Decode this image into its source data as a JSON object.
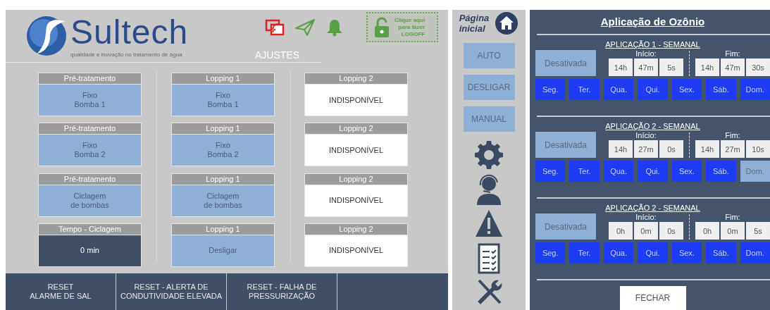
{
  "header": {
    "brand": "Sultech",
    "tagline": "qualidade e inovação no tratamento de água",
    "logoff": "Clique aqui\npara fazer\nLOGOFF",
    "section_title": "AJUSTES"
  },
  "cards": [
    {
      "label": "Pré-tratamento",
      "value": "Fixo\nBomba 1",
      "kind": "mode"
    },
    {
      "label": "Lopping 1",
      "value": "Fixo\nBomba 1",
      "kind": "mode"
    },
    {
      "label": "Lopping 2",
      "value": "INDISPONÍVEL",
      "kind": "unavailable"
    },
    {
      "label": "Pré-tratamento",
      "value": "Fixo\nBomba 2",
      "kind": "mode"
    },
    {
      "label": "Lopping 1",
      "value": "Fixo\nBomba 2",
      "kind": "mode"
    },
    {
      "label": "Lopping 2",
      "value": "INDISPONÍVEL",
      "kind": "unavailable"
    },
    {
      "label": "Pré-tratamento",
      "value": "Ciclagem\nde bombas",
      "kind": "mode"
    },
    {
      "label": "Lopping 1",
      "value": "Ciclagem\nde bombas",
      "kind": "mode"
    },
    {
      "label": "Lopping 2",
      "value": "INDISPONÍVEL",
      "kind": "unavailable"
    },
    {
      "label": "Tempo - Ciclagem",
      "value": "0 min",
      "kind": "time"
    },
    {
      "label": "Lopping 1",
      "value": "Desligar",
      "kind": "mode"
    },
    {
      "label": "Lopping 2",
      "value": "INDISPONÍVEL",
      "kind": "unavailable"
    }
  ],
  "reset_buttons": [
    "RESET\nALARME DE SAL",
    "RESET - ALERTA DE\nCONDUTIVIDADE ELEVADA",
    "RESET - FALHA DE\nPRESSURIZAÇÃO"
  ],
  "sidebar": {
    "home_label": "Página\ninicial",
    "mode_buttons": [
      "AUTO",
      "DESLIGAR",
      "MANUAL"
    ]
  },
  "dialog": {
    "title": "Aplicação de Ozônio",
    "applications": [
      {
        "title": "APLICAÇÃO 1 - SEMANAL",
        "status": "Desativada",
        "start_label": "Início:",
        "start": [
          "14h",
          "47m",
          "5s"
        ],
        "end_label": "Fim:",
        "end": [
          "14h",
          "47m",
          "30s"
        ],
        "days": [
          {
            "label": "Seg.",
            "selected": true
          },
          {
            "label": "Ter.",
            "selected": true
          },
          {
            "label": "Qua.",
            "selected": true
          },
          {
            "label": "Qui.",
            "selected": true
          },
          {
            "label": "Sex.",
            "selected": true
          },
          {
            "label": "Sáb.",
            "selected": true
          },
          {
            "label": "Dom.",
            "selected": true
          }
        ]
      },
      {
        "title": "APLICAÇÃO 2 - SEMANAL",
        "status": "Desativada",
        "start_label": "Início:",
        "start": [
          "14h",
          "27m",
          "0s"
        ],
        "end_label": "Fim:",
        "end": [
          "14h",
          "27m",
          "10s"
        ],
        "days": [
          {
            "label": "Seg.",
            "selected": true
          },
          {
            "label": "Ter.",
            "selected": true
          },
          {
            "label": "Qua.",
            "selected": true
          },
          {
            "label": "Qui.",
            "selected": true
          },
          {
            "label": "Sex.",
            "selected": true
          },
          {
            "label": "Sáb.",
            "selected": true
          },
          {
            "label": "Dom.",
            "selected": false
          }
        ]
      },
      {
        "title": "APLICAÇÃO 2 - SEMANAL",
        "status": "Desativada",
        "start_label": "Início:",
        "start": [
          "0h",
          "0m",
          "0s"
        ],
        "end_label": "Fim:",
        "end": [
          "0h",
          "0m",
          "5s"
        ],
        "days": [
          {
            "label": "Seg.",
            "selected": true
          },
          {
            "label": "Ter.",
            "selected": true
          },
          {
            "label": "Qua.",
            "selected": true
          },
          {
            "label": "Qui.",
            "selected": true
          },
          {
            "label": "Sex.",
            "selected": true
          },
          {
            "label": "Sáb.",
            "selected": true
          },
          {
            "label": "Dom.",
            "selected": true
          }
        ]
      }
    ],
    "close_button": "FECHAR"
  }
}
